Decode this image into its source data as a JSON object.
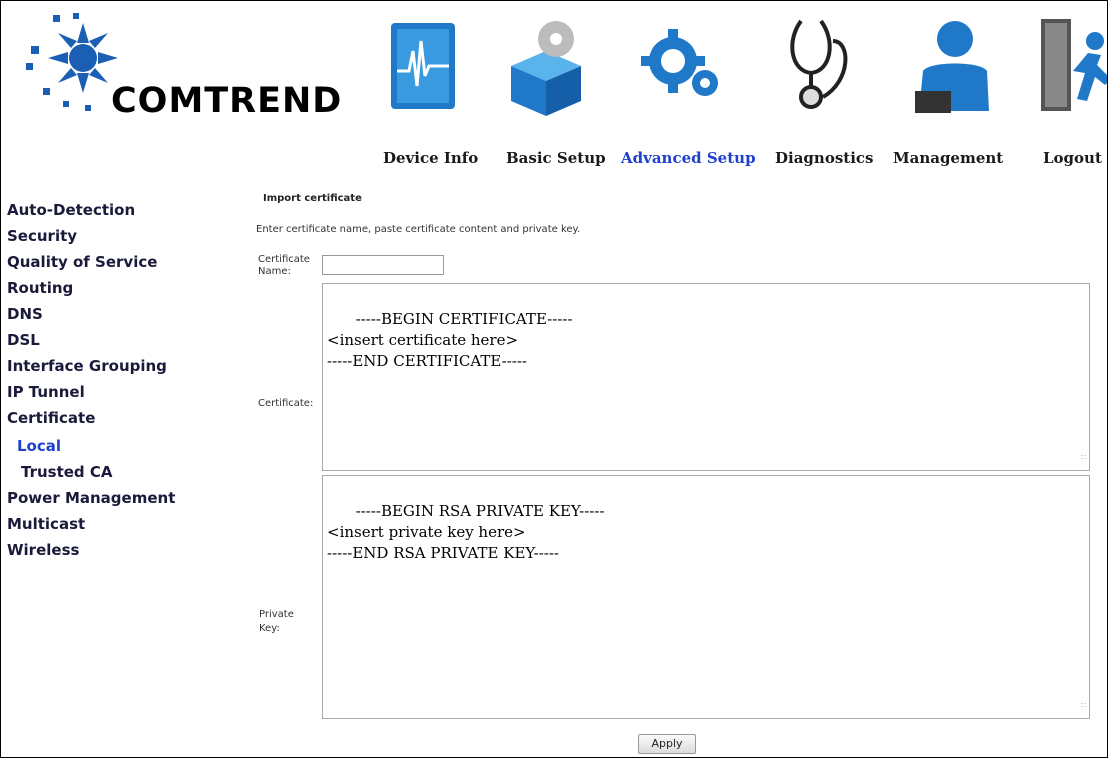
{
  "brand": {
    "name": "COMTREND"
  },
  "nav": {
    "items": [
      {
        "label": "Device Info",
        "icon": "device-info-icon"
      },
      {
        "label": "Basic Setup",
        "icon": "basic-setup-icon"
      },
      {
        "label": "Advanced Setup",
        "icon": "advanced-setup-icon",
        "active": true
      },
      {
        "label": "Diagnostics",
        "icon": "stethoscope-icon"
      },
      {
        "label": "Management",
        "icon": "management-icon"
      },
      {
        "label": "Logout",
        "icon": "logout-icon"
      }
    ]
  },
  "sidebar": {
    "items": [
      {
        "label": "Auto-Detection"
      },
      {
        "label": "Security"
      },
      {
        "label": "Quality of Service"
      },
      {
        "label": "Routing"
      },
      {
        "label": "DNS"
      },
      {
        "label": "DSL"
      },
      {
        "label": "Interface Grouping"
      },
      {
        "label": "IP Tunnel"
      },
      {
        "label": "Certificate"
      },
      {
        "label": "Local",
        "active": true
      },
      {
        "label": "Trusted CA"
      },
      {
        "label": "Power Management"
      },
      {
        "label": "Multicast"
      },
      {
        "label": "Wireless"
      }
    ]
  },
  "main": {
    "section_title": "Import certificate",
    "instructions": "Enter certificate name, paste certificate content and private key.",
    "name_label": "Certificate Name:",
    "name_value": "",
    "cert_label": "Certificate:",
    "cert_value": "-----BEGIN CERTIFICATE-----\n<insert certificate here>\n-----END CERTIFICATE-----",
    "key_label": "Private Key:",
    "key_value": "-----BEGIN RSA PRIVATE KEY-----\n<insert private key here>\n-----END RSA PRIVATE KEY-----",
    "apply_label": "Apply"
  },
  "colors": {
    "active_link": "#1f3fcc",
    "icon_blue": "#1f78c8",
    "logo_blue": "#1a5fb4"
  }
}
